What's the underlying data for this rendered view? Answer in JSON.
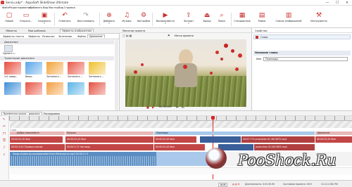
{
  "window": {
    "title": "Sensu.adp* - AquaSoft SlideShow Ultimate",
    "controls": {
      "minimize": "—",
      "maximize": "☐",
      "close": "✕"
    }
  },
  "menu": [
    "Файл",
    "Редактирование",
    "Добавить",
    "Вид",
    "Мастер",
    "Вид",
    "Справка"
  ],
  "toolbar": [
    {
      "label": "Новый",
      "icon": "new-file-icon"
    },
    {
      "label": "Открыть...",
      "icon": "open-folder-icon"
    },
    {
      "label": "Сохранить",
      "icon": "save-icon"
    },
    {
      "label": "Отменить",
      "icon": "undo-icon"
    },
    {
      "label": "Восстановить",
      "icon": "redo-icon"
    },
    {
      "label": "Добавить",
      "icon": "add-icon"
    },
    {
      "label": "Музыка",
      "icon": "music-icon"
    },
    {
      "label": "Настройки",
      "icon": "settings-icon"
    },
    {
      "label": "Воспроизвести",
      "icon": "play-icon"
    },
    {
      "label": "Экспорт",
      "icon": "export-icon"
    },
    {
      "label": "Выход",
      "icon": "exit-icon"
    },
    {
      "label": "Поиск",
      "icon": "search-icon"
    },
    {
      "label": "Стандартные",
      "icon": "layout-standard-icon"
    },
    {
      "label": "Рамки",
      "icon": "layout-frames-icon"
    },
    {
      "label": "Список изображений",
      "icon": "image-list-icon"
    },
    {
      "label": "Инструменты",
      "icon": "tools-icon"
    }
  ],
  "objects_panel": {
    "tabs": [
      "Объекты",
      "Мои шаблоны",
      "Эффекты изображения"
    ],
    "subtabs": [
      "Эффекты текста",
      "Эффекты",
      "Размытие",
      "Затенение",
      "Файлы",
      "Движение"
    ],
    "section_movement": "Движения",
    "motion_item_caption": "Удалить т...",
    "section_paths": "Траектории движения",
    "tiles": [
      {
        "caption": "2x2 повер...",
        "color": "#e84c3d"
      },
      {
        "caption": "Вверх",
        "color": "#5aa6e8"
      },
      {
        "caption": "Затемнить ...",
        "color": "#f2a33a"
      },
      {
        "caption": "Затемнить ...",
        "color": "#e95a4a"
      },
      {
        "caption": "Затемнить ...",
        "color": "#f0c030"
      },
      {
        "caption": "",
        "color": "#3e8fd8"
      },
      {
        "caption": "",
        "color": "#e75343"
      },
      {
        "caption": "",
        "color": "#f29e40"
      },
      {
        "caption": "",
        "color": "#5ab3e6"
      },
      {
        "caption": "",
        "color": "#e44f3f"
      }
    ]
  },
  "monitor": {
    "title": "Монитор проекта",
    "overlay_label": "Метки времени",
    "time": "00:00:000"
  },
  "properties": {
    "title": "Свойства",
    "tab": "Глава",
    "section": "Название главы",
    "field_label": "Имя",
    "field_value": "Переходы"
  },
  "timeline": {
    "tabs": [
      "Временная шкала - дорожки",
      "Раскадровка"
    ],
    "groups": [
      {
        "label": "Добро пожаловать",
        "color": "#e8a0a0"
      },
      {
        "label": "Музыка",
        "color": "#e8a0a0"
      },
      {
        "label": "Переходы",
        "color": "#7fb2dd"
      },
      {
        "label": "Движение",
        "color": "#e8a0a0"
      }
    ],
    "row1": [
      {
        "label": "00:00:02,00 Фон"
      },
      {
        "label": "00:00:02,00 Фон"
      },
      {
        "label": "00:00:02,00 Фон"
      },
      {
        "label": "00:07:774 production ID 4813870.mp4"
      },
      {
        "label": "00:00:02,00 Фон"
      }
    ],
    "row2": [
      {
        "label": "00:00:3,00 Прямоугольник"
      },
      {
        "label": "00:00:3,72 Частицы"
      },
      {
        "label": "00:00:02,00 Фон"
      },
      {
        "label": "production ID 4813855.mp4"
      }
    ],
    "audio_label": "Songs-of-glee-by-musicparadise-from-filmmusic-io-mp3 00:00:17,5",
    "ruler_text": "0:00",
    "first_marker": "1 шаг"
  },
  "status": {
    "mode": "NUM",
    "duration": "Длительность: 0:01:35.90",
    "state": "Состояние проекта: 00:9",
    "coords": "11:11:1:58.790"
  },
  "watermark": "PooShock.Ru",
  "colors": {
    "accent": "#c9302c",
    "blue": "#3e85c9"
  }
}
